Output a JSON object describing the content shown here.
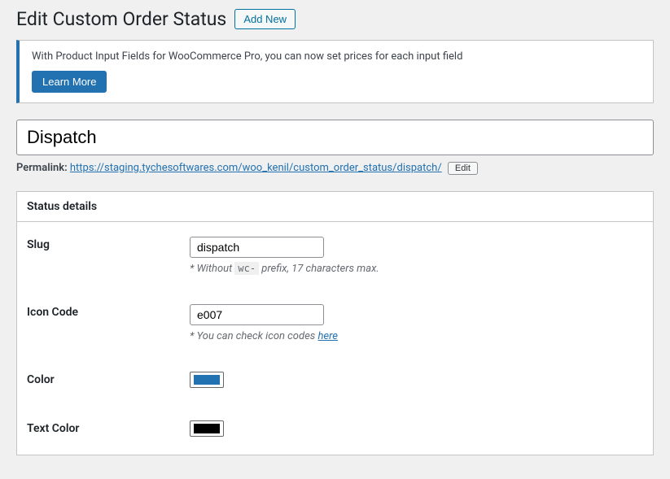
{
  "header": {
    "title": "Edit Custom Order Status",
    "add_new_label": "Add New"
  },
  "notice": {
    "text": "With Product Input Fields for WooCommerce Pro, you can now set prices for each input field",
    "button_label": "Learn More"
  },
  "post": {
    "title": "Dispatch",
    "permalink_label": "Permalink:",
    "permalink_base": "https://staging.tychesoftwares.com/woo_kenil/custom_order_status/",
    "permalink_slug": "dispatch",
    "permalink_trail": "/",
    "edit_label": "Edit"
  },
  "metabox": {
    "title": "Status details",
    "fields": {
      "slug": {
        "label": "Slug",
        "value": "dispatch",
        "hint_prefix": "* Without ",
        "hint_code": "wc-",
        "hint_suffix": " prefix, 17 characters max."
      },
      "icon": {
        "label": "Icon Code",
        "value": "e007",
        "hint_prefix": "* You can check icon codes ",
        "hint_link_text": "here"
      },
      "color": {
        "label": "Color",
        "value": "#2271b1"
      },
      "text_color": {
        "label": "Text Color",
        "value": "#000000"
      }
    }
  }
}
